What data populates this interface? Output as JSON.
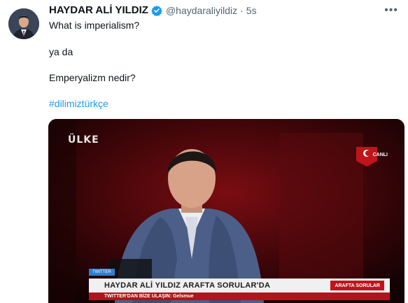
{
  "tweet": {
    "display_name": "HAYDAR ALİ YILDIZ",
    "handle": "@haydaraliyildiz",
    "separator": "·",
    "time": "5s",
    "more_icon": "more-horizontal-icon",
    "lines": [
      "What is imperialism?",
      "ya da",
      "Emperyalizm nedir?"
    ],
    "hashtag": "#dilimiztürkçe"
  },
  "media": {
    "channel_logo": "ÜLKE",
    "live_label": "CANLI",
    "source_label": "TWITTER",
    "banner_title": "HAYDAR ALİ YILDIZ ARAFTA SORULAR'DA",
    "banner_tag": "ARAFTA SORULAR",
    "ticker_text": "TWITTER'DAN BİZE ULAŞIN: Gelsmue"
  },
  "colors": {
    "accent": "#1d9bf0",
    "text": "#0f1419",
    "muted": "#536471",
    "banner_red": "#c0141b"
  }
}
